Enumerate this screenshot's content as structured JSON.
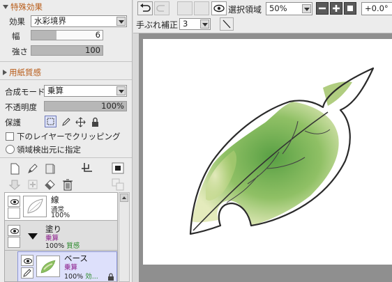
{
  "special_effects": {
    "header": "特殊効果",
    "effect_label": "効果",
    "effect_value": "水彩境界",
    "width_label": "幅",
    "width_value": "6",
    "width_fraction": 0.35,
    "strength_label": "強さ",
    "strength_value": "100",
    "strength_fraction": 1.0
  },
  "paper_texture": {
    "header": "用紙質感"
  },
  "layer_props": {
    "blend_label": "合成モード",
    "blend_value": "乗算",
    "opacity_label": "不透明度",
    "opacity_value": "100%",
    "opacity_fraction": 1.0,
    "protect_label": "保護",
    "clip_label": "下のレイヤーでクリッピング",
    "detect_label": "領域検出元に指定"
  },
  "layers": [
    {
      "name": "線",
      "mode": "通常",
      "opacity": "100%",
      "extra": ""
    },
    {
      "name": "塗り",
      "mode": "乗算",
      "opacity": "100%",
      "extra": "質感"
    },
    {
      "name": "ベース",
      "mode": "乗算",
      "opacity": "100%",
      "extra": "効..."
    }
  ],
  "toolbar": {
    "selection_label": "選択領域",
    "zoom_value": "50%",
    "rotation_value": "+0.0°",
    "stabilizer_label": "手ぶれ補正",
    "stabilizer_value": "3"
  },
  "colors": {
    "header_orange": "#b85b17",
    "mode_purple": "#8c1d8c",
    "extra_green": "#2a8a2a",
    "canvas_gray": "#8f8f8f",
    "selected_layer": "#dde0fb"
  }
}
